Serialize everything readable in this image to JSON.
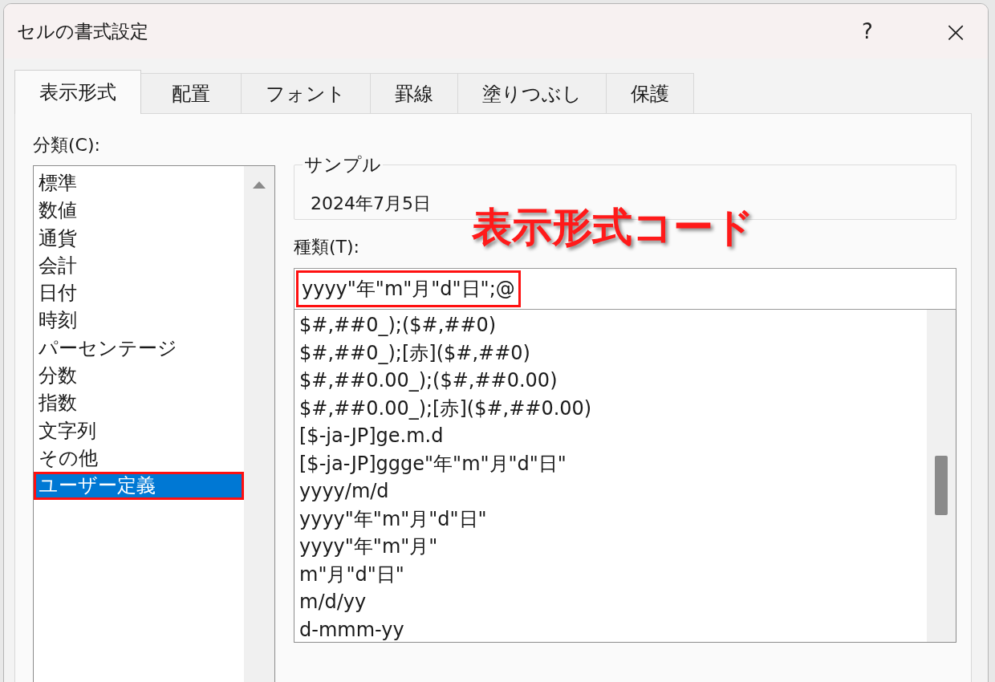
{
  "window": {
    "title": "セルの書式設定",
    "help_button": "?",
    "close_button": "×"
  },
  "tabs": [
    {
      "label": "表示形式",
      "selected": true
    },
    {
      "label": "配置",
      "selected": false
    },
    {
      "label": "フォント",
      "selected": false
    },
    {
      "label": "罫線",
      "selected": false
    },
    {
      "label": "塗りつぶし",
      "selected": false
    },
    {
      "label": "保護",
      "selected": false
    }
  ],
  "category": {
    "label": "分類(C):",
    "items": [
      {
        "label": "標準",
        "selected": false,
        "highlighted": false
      },
      {
        "label": "数値",
        "selected": false,
        "highlighted": false
      },
      {
        "label": "通貨",
        "selected": false,
        "highlighted": false
      },
      {
        "label": "会計",
        "selected": false,
        "highlighted": false
      },
      {
        "label": "日付",
        "selected": false,
        "highlighted": false
      },
      {
        "label": "時刻",
        "selected": false,
        "highlighted": false
      },
      {
        "label": "パーセンテージ",
        "selected": false,
        "highlighted": false
      },
      {
        "label": "分数",
        "selected": false,
        "highlighted": false
      },
      {
        "label": "指数",
        "selected": false,
        "highlighted": false
      },
      {
        "label": "文字列",
        "selected": false,
        "highlighted": false
      },
      {
        "label": "その他",
        "selected": false,
        "highlighted": false
      },
      {
        "label": "ユーザー定義",
        "selected": true,
        "highlighted": true
      }
    ]
  },
  "sample": {
    "label": "サンプル",
    "value": "2024年7月5日"
  },
  "annotation": "表示形式コード",
  "type": {
    "label": "種類(T):",
    "value": "yyyy\"年\"m\"月\"d\"日\";@",
    "highlighted": true,
    "items": [
      "$#,##0_);($#,##0)",
      "$#,##0_);[赤]($#,##0)",
      "$#,##0.00_);($#,##0.00)",
      "$#,##0.00_);[赤]($#,##0.00)",
      "[$-ja-JP]ge.m.d",
      "[$-ja-JP]ggge\"年\"m\"月\"d\"日\"",
      "yyyy/m/d",
      "yyyy\"年\"m\"月\"d\"日\"",
      "yyyy\"年\"m\"月\"",
      "m\"月\"d\"日\"",
      "m/d/yy",
      "d-mmm-yy"
    ]
  }
}
